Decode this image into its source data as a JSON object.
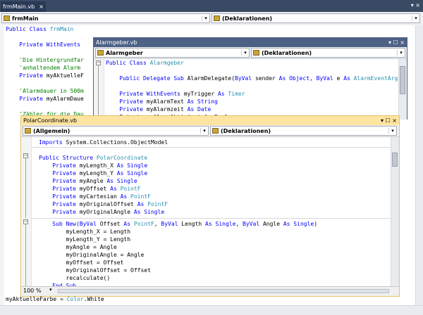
{
  "main": {
    "tab_label": "frmMain.vb",
    "tab_close": "×",
    "tabstrip_right": "▾ ×",
    "nav_left": "frmMain",
    "nav_right": "(Deklarationen)",
    "lines": [
      {
        "parts": [
          {
            "t": "Public Class ",
            "c": "kw"
          },
          {
            "t": "frmMain",
            "c": "ty"
          }
        ]
      },
      {
        "parts": [
          {
            "t": "",
            "c": ""
          }
        ]
      },
      {
        "parts": [
          {
            "t": "    Private WithEvents",
            "c": "kw"
          }
        ]
      },
      {
        "parts": [
          {
            "t": "",
            "c": ""
          }
        ]
      },
      {
        "parts": [
          {
            "t": "    'Die Hintergrundfar",
            "c": "cm"
          }
        ]
      },
      {
        "parts": [
          {
            "t": "    'anhaltendem Alarm",
            "c": "cm"
          }
        ]
      },
      {
        "parts": [
          {
            "t": "    Private ",
            "c": "kw"
          },
          {
            "t": "myAktuelleF",
            "c": ""
          }
        ]
      },
      {
        "parts": [
          {
            "t": "",
            "c": ""
          }
        ]
      },
      {
        "parts": [
          {
            "t": "    'Alarmdauer in 500m",
            "c": "cm"
          }
        ]
      },
      {
        "parts": [
          {
            "t": "    Private ",
            "c": "kw"
          },
          {
            "t": "myAlarmDaue",
            "c": ""
          }
        ]
      },
      {
        "parts": [
          {
            "t": "",
            "c": ""
          }
        ]
      },
      {
        "parts": [
          {
            "t": "    'Zähler für die Dau",
            "c": "cm"
          }
        ]
      }
    ],
    "bottom_line": {
      "parts": [
        {
          "t": "myAktuelleFarbe = ",
          "c": ""
        },
        {
          "t": "Color",
          "c": "ty"
        },
        {
          "t": ".White",
          "c": ""
        }
      ]
    }
  },
  "alarm": {
    "title": "Alarmgeber.vb",
    "title_buttons": "▾ ☐ ×",
    "nav_left": "Alarmgeber",
    "nav_right": "(Deklarationen)",
    "lines": [
      {
        "parts": [
          {
            "t": "Public Class ",
            "c": "kw"
          },
          {
            "t": "Alarmgeber",
            "c": "ty"
          }
        ]
      },
      {
        "parts": [
          {
            "t": "",
            "c": ""
          }
        ]
      },
      {
        "parts": [
          {
            "t": "    Public Delegate Sub ",
            "c": "kw"
          },
          {
            "t": "AlarmDelegate(",
            "c": ""
          },
          {
            "t": "ByVal ",
            "c": "kw"
          },
          {
            "t": "sender ",
            "c": ""
          },
          {
            "t": "As Object",
            "c": "kw"
          },
          {
            "t": ", ",
            "c": ""
          },
          {
            "t": "ByVal ",
            "c": "kw"
          },
          {
            "t": "e ",
            "c": ""
          },
          {
            "t": "As ",
            "c": "kw"
          },
          {
            "t": "AlarmEventArgs",
            "c": "ty"
          },
          {
            "t": ")",
            "c": ""
          }
        ]
      },
      {
        "parts": [
          {
            "t": "",
            "c": ""
          }
        ]
      },
      {
        "parts": [
          {
            "t": "    Private WithEvents ",
            "c": "kw"
          },
          {
            "t": "myTrigger ",
            "c": ""
          },
          {
            "t": "As ",
            "c": "kw"
          },
          {
            "t": "Timer",
            "c": "ty"
          }
        ]
      },
      {
        "parts": [
          {
            "t": "    Private ",
            "c": "kw"
          },
          {
            "t": "myAlarmText ",
            "c": ""
          },
          {
            "t": "As String",
            "c": "kw"
          }
        ]
      },
      {
        "parts": [
          {
            "t": "    Private ",
            "c": "kw"
          },
          {
            "t": "myAlarmzeit ",
            "c": ""
          },
          {
            "t": "As Date",
            "c": "kw"
          }
        ]
      },
      {
        "parts": [
          {
            "t": "    Private ",
            "c": "kw"
          },
          {
            "t": "myAlarmAktiviert ",
            "c": ""
          },
          {
            "t": "As Boolean",
            "c": "kw"
          }
        ]
      }
    ]
  },
  "polar": {
    "title": "PolarCoordinate.vb",
    "title_buttons": "▾ ☐ ×",
    "nav_left": "(Allgemein)",
    "nav_right": "(Deklarationen)",
    "zoom": "100 %",
    "imports_line": {
      "parts": [
        {
          "t": "Imports ",
          "c": "kw"
        },
        {
          "t": "System.Collections.ObjectModel",
          "c": ""
        }
      ]
    },
    "block1": [
      {
        "parts": [
          {
            "t": "Public Structure ",
            "c": "kw"
          },
          {
            "t": "PolarCoordinate",
            "c": "ty"
          }
        ]
      },
      {
        "parts": [
          {
            "t": "    Private ",
            "c": "kw"
          },
          {
            "t": "myLength_X ",
            "c": ""
          },
          {
            "t": "As Single",
            "c": "kw"
          }
        ]
      },
      {
        "parts": [
          {
            "t": "    Private ",
            "c": "kw"
          },
          {
            "t": "myLength_Y ",
            "c": ""
          },
          {
            "t": "As Single",
            "c": "kw"
          }
        ]
      },
      {
        "parts": [
          {
            "t": "    Private ",
            "c": "kw"
          },
          {
            "t": "myAngle ",
            "c": ""
          },
          {
            "t": "As Single",
            "c": "kw"
          }
        ]
      },
      {
        "parts": [
          {
            "t": "    Private ",
            "c": "kw"
          },
          {
            "t": "myOffset ",
            "c": ""
          },
          {
            "t": "As ",
            "c": "kw"
          },
          {
            "t": "PointF",
            "c": "ty"
          }
        ]
      },
      {
        "parts": [
          {
            "t": "    Private ",
            "c": "kw"
          },
          {
            "t": "myCartesian ",
            "c": ""
          },
          {
            "t": "As ",
            "c": "kw"
          },
          {
            "t": "PointF",
            "c": "ty"
          }
        ]
      },
      {
        "parts": [
          {
            "t": "    Private ",
            "c": "kw"
          },
          {
            "t": "myOriginalOffset ",
            "c": ""
          },
          {
            "t": "As ",
            "c": "kw"
          },
          {
            "t": "PointF",
            "c": "ty"
          }
        ]
      },
      {
        "parts": [
          {
            "t": "    Private ",
            "c": "kw"
          },
          {
            "t": "myOriginalAngle ",
            "c": ""
          },
          {
            "t": "As Single",
            "c": "kw"
          }
        ]
      }
    ],
    "block2": [
      {
        "parts": [
          {
            "t": "    Sub New(",
            "c": "kw"
          },
          {
            "t": "ByVal ",
            "c": "kw"
          },
          {
            "t": "Offset ",
            "c": ""
          },
          {
            "t": "As ",
            "c": "kw"
          },
          {
            "t": "PointF",
            "c": "ty"
          },
          {
            "t": ", ",
            "c": ""
          },
          {
            "t": "ByVal ",
            "c": "kw"
          },
          {
            "t": "Length ",
            "c": ""
          },
          {
            "t": "As Single",
            "c": "kw"
          },
          {
            "t": ", ",
            "c": ""
          },
          {
            "t": "ByVal ",
            "c": "kw"
          },
          {
            "t": "Angle ",
            "c": ""
          },
          {
            "t": "As Single",
            "c": "kw"
          },
          {
            "t": ")",
            "c": ""
          }
        ]
      },
      {
        "parts": [
          {
            "t": "        myLength_X = Length",
            "c": ""
          }
        ]
      },
      {
        "parts": [
          {
            "t": "        myLength_Y = Length",
            "c": ""
          }
        ]
      },
      {
        "parts": [
          {
            "t": "        myAngle = Angle",
            "c": ""
          }
        ]
      },
      {
        "parts": [
          {
            "t": "        myOriginalAngle = Angle",
            "c": ""
          }
        ]
      },
      {
        "parts": [
          {
            "t": "        myOffset = Offset",
            "c": ""
          }
        ]
      },
      {
        "parts": [
          {
            "t": "        myOriginalOffset = Offset",
            "c": ""
          }
        ]
      },
      {
        "parts": [
          {
            "t": "        recalculate()",
            "c": ""
          }
        ]
      },
      {
        "parts": [
          {
            "t": "    End Sub",
            "c": "kw"
          }
        ]
      }
    ]
  }
}
